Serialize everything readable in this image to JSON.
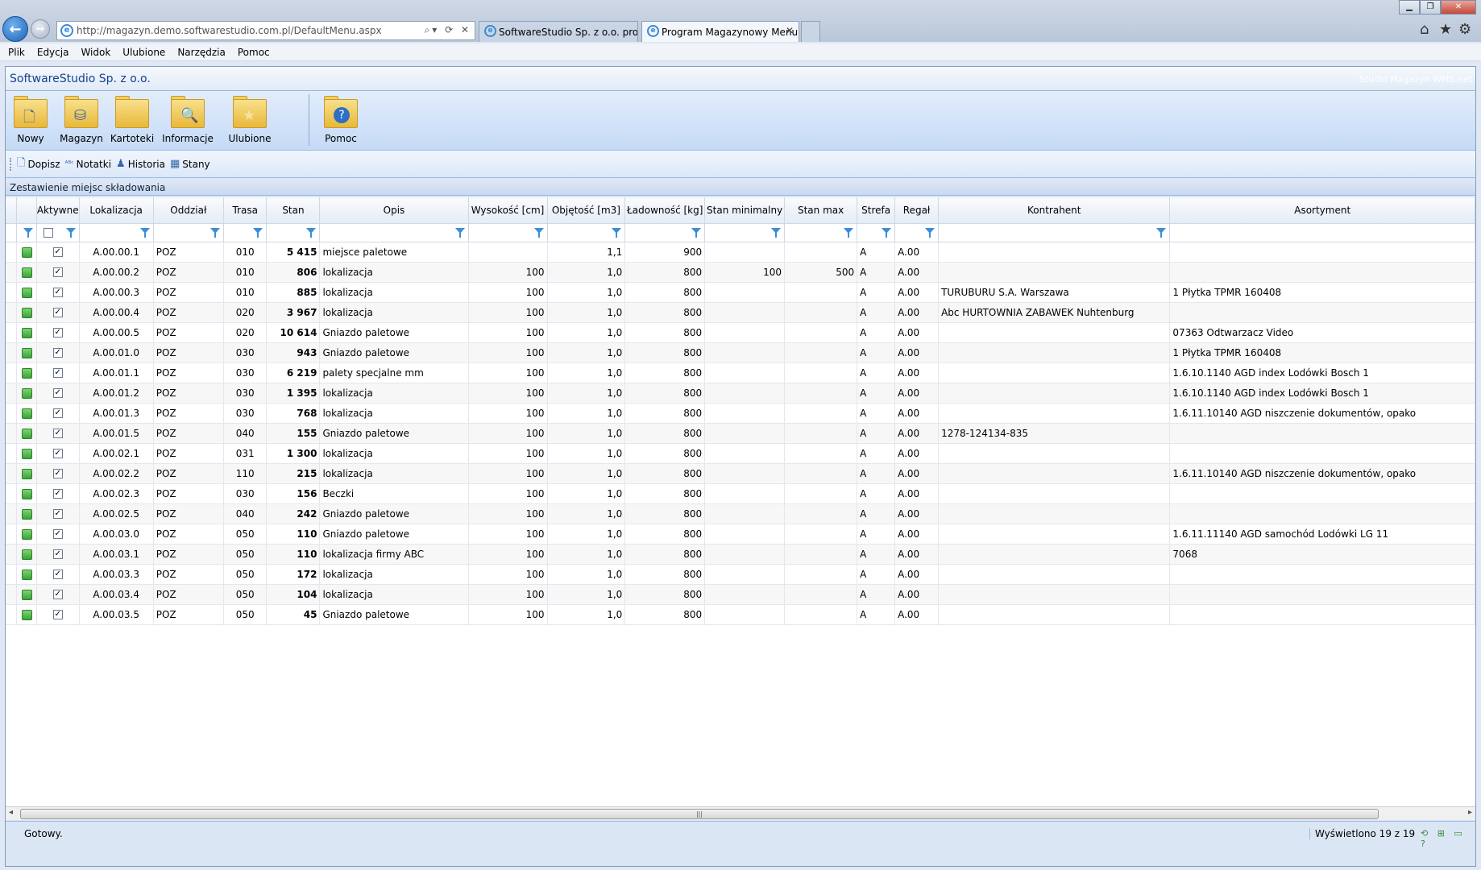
{
  "browser": {
    "url": "http://magazyn.demo.softwarestudio.com.pl/DefaultMenu.aspx",
    "tabs": [
      {
        "label": "SoftwareStudio Sp. z o.o. prod..."
      },
      {
        "label": "Program Magazynowy Menu"
      }
    ]
  },
  "menubar": [
    "Plik",
    "Edycja",
    "Widok",
    "Ulubione",
    "Narzędzia",
    "Pomoc"
  ],
  "app": {
    "company": "SoftwareStudio Sp. z o.o.",
    "product": "Studio Magazyn WMS.net"
  },
  "ribbon": [
    {
      "label": "Nowy",
      "icon": "new-document-icon"
    },
    {
      "label": "Magazyn",
      "icon": "database-icon"
    },
    {
      "label": "Kartoteki",
      "icon": "folder-icon"
    },
    {
      "label": "Informacje",
      "icon": "magnifier-icon"
    },
    {
      "label": "Ulubione",
      "icon": "star-icon"
    },
    {
      "label": "Pomoc",
      "icon": "help-icon"
    }
  ],
  "toolbar": [
    {
      "label": "Dopisz",
      "icon": "add-page-icon"
    },
    {
      "label": "Notatki",
      "icon": "abc-notes-icon"
    },
    {
      "label": "Historia",
      "icon": "history-icon"
    },
    {
      "label": "Stany",
      "icon": "table-icon"
    }
  ],
  "panel_title": "Zestawienie miejsc składowania",
  "columns": [
    "",
    "Aktywne",
    "Lokalizacja",
    "Oddział",
    "Trasa",
    "Stan",
    "Opis",
    "Wysokość [cm]",
    "Objętość [m3]",
    "Ładowność [kg]",
    "Stan minimalny",
    "Stan max",
    "Strefa",
    "Regał",
    "Kontrahent",
    "Asortyment"
  ],
  "rows": [
    [
      "A.00.00.1",
      "POZ",
      "010",
      "5 415",
      "miejsce paletowe",
      "",
      "1,1",
      "900",
      "",
      "",
      "A",
      "A.00",
      "",
      ""
    ],
    [
      "A.00.00.2",
      "POZ",
      "010",
      "806",
      "lokalizacja",
      "100",
      "1,0",
      "800",
      "100",
      "500",
      "A",
      "A.00",
      "",
      ""
    ],
    [
      "A.00.00.3",
      "POZ",
      "010",
      "885",
      "lokalizacja",
      "100",
      "1,0",
      "800",
      "",
      "",
      "A",
      "A.00",
      "TURUBURU S.A. Warszawa",
      "1 Płytka TPMR 160408"
    ],
    [
      "A.00.00.4",
      "POZ",
      "020",
      "3 967",
      "lokalizacja",
      "100",
      "1,0",
      "800",
      "",
      "",
      "A",
      "A.00",
      "Abc HURTOWNIA ZABAWEK Nuhtenburg",
      ""
    ],
    [
      "A.00.00.5",
      "POZ",
      "020",
      "10 614",
      "Gniazdo paletowe",
      "100",
      "1,0",
      "800",
      "",
      "",
      "A",
      "A.00",
      "",
      "07363 Odtwarzacz Video"
    ],
    [
      "A.00.01.0",
      "POZ",
      "030",
      "943",
      "Gniazdo paletowe",
      "100",
      "1,0",
      "800",
      "",
      "",
      "A",
      "A.00",
      "",
      "1 Płytka TPMR 160408"
    ],
    [
      "A.00.01.1",
      "POZ",
      "030",
      "6 219",
      "palety specjalne mm",
      "100",
      "1,0",
      "800",
      "",
      "",
      "A",
      "A.00",
      "",
      "1.6.10.1140 AGD index Lodówki Bosch 1"
    ],
    [
      "A.00.01.2",
      "POZ",
      "030",
      "1 395",
      "lokalizacja",
      "100",
      "1,0",
      "800",
      "",
      "",
      "A",
      "A.00",
      "",
      "1.6.10.1140 AGD index Lodówki Bosch 1"
    ],
    [
      "A.00.01.3",
      "POZ",
      "030",
      "768",
      "lokalizacja",
      "100",
      "1,0",
      "800",
      "",
      "",
      "A",
      "A.00",
      "",
      "1.6.11.10140 AGD niszczenie dokumentów, opako"
    ],
    [
      "A.00.01.5",
      "POZ",
      "040",
      "155",
      "Gniazdo paletowe",
      "100",
      "1,0",
      "800",
      "",
      "",
      "A",
      "A.00",
      "1278-124134-835",
      ""
    ],
    [
      "A.00.02.1",
      "POZ",
      "031",
      "1 300",
      "lokalizacja",
      "100",
      "1,0",
      "800",
      "",
      "",
      "A",
      "A.00",
      "",
      ""
    ],
    [
      "A.00.02.2",
      "POZ",
      "110",
      "215",
      "lokalizacja",
      "100",
      "1,0",
      "800",
      "",
      "",
      "A",
      "A.00",
      "",
      "1.6.11.10140 AGD niszczenie dokumentów, opako"
    ],
    [
      "A.00.02.3",
      "POZ",
      "030",
      "156",
      "Beczki",
      "100",
      "1,0",
      "800",
      "",
      "",
      "A",
      "A.00",
      "",
      ""
    ],
    [
      "A.00.02.5",
      "POZ",
      "040",
      "242",
      "Gniazdo paletowe",
      "100",
      "1,0",
      "800",
      "",
      "",
      "A",
      "A.00",
      "",
      ""
    ],
    [
      "A.00.03.0",
      "POZ",
      "050",
      "110",
      "Gniazdo paletowe",
      "100",
      "1,0",
      "800",
      "",
      "",
      "A",
      "A.00",
      "",
      "1.6.11.11140 AGD samochód Lodówki LG 11"
    ],
    [
      "A.00.03.1",
      "POZ",
      "050",
      "110",
      "lokalizacja firmy ABC",
      "100",
      "1,0",
      "800",
      "",
      "",
      "A",
      "A.00",
      "",
      "7068"
    ],
    [
      "A.00.03.3",
      "POZ",
      "050",
      "172",
      "lokalizacja",
      "100",
      "1,0",
      "800",
      "",
      "",
      "A",
      "A.00",
      "",
      ""
    ],
    [
      "A.00.03.4",
      "POZ",
      "050",
      "104",
      "lokalizacja",
      "100",
      "1,0",
      "800",
      "",
      "",
      "A",
      "A.00",
      "",
      ""
    ],
    [
      "A.00.03.5",
      "POZ",
      "050",
      "45",
      "Gniazdo paletowe",
      "100",
      "1,0",
      "800",
      "",
      "",
      "A",
      "A.00",
      "",
      ""
    ]
  ],
  "status": {
    "left": "Gotowy.",
    "count": "Wyświetlono 19 z 19"
  }
}
